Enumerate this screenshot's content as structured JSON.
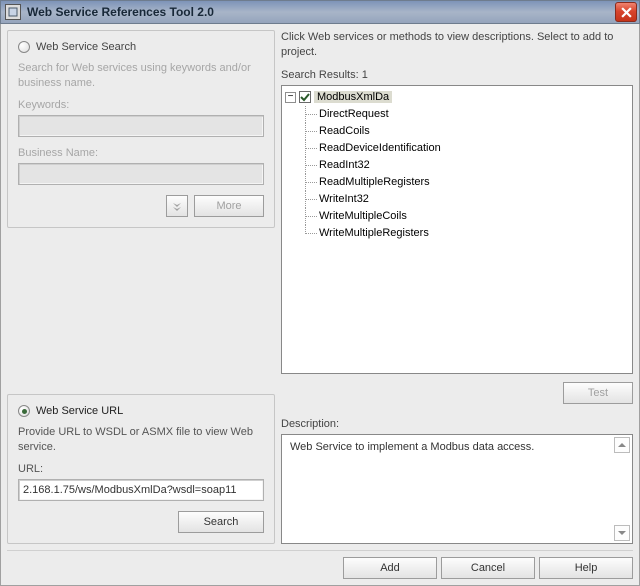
{
  "window": {
    "title": "Web Service References Tool 2.0"
  },
  "left": {
    "search": {
      "title": "Web Service Search",
      "hint": "Search for Web services using keywords and/or business name.",
      "keywords_label": "Keywords:",
      "keywords_value": "",
      "business_label": "Business Name:",
      "business_value": "",
      "more_label": "More"
    },
    "url": {
      "title": "Web Service URL",
      "hint": "Provide URL to WSDL or ASMX file to view Web service.",
      "url_label": "URL:",
      "url_value": "2.168.1.75/ws/ModbusXmlDa?wsdl=soap11",
      "search_label": "Search"
    }
  },
  "right": {
    "instruction": "Click Web services or methods to view descriptions. Select to add to project.",
    "results_label": "Search Results: 1",
    "tree": {
      "root": "ModbusXmlDa",
      "children": [
        "DirectRequest",
        "ReadCoils",
        "ReadDeviceIdentification",
        "ReadInt32",
        "ReadMultipleRegisters",
        "WriteInt32",
        "WriteMultipleCoils",
        "WriteMultipleRegisters"
      ]
    },
    "test_label": "Test",
    "description_label": "Description:",
    "description_text": "Web Service to implement a Modbus data access."
  },
  "footer": {
    "add": "Add",
    "cancel": "Cancel",
    "help": "Help"
  }
}
